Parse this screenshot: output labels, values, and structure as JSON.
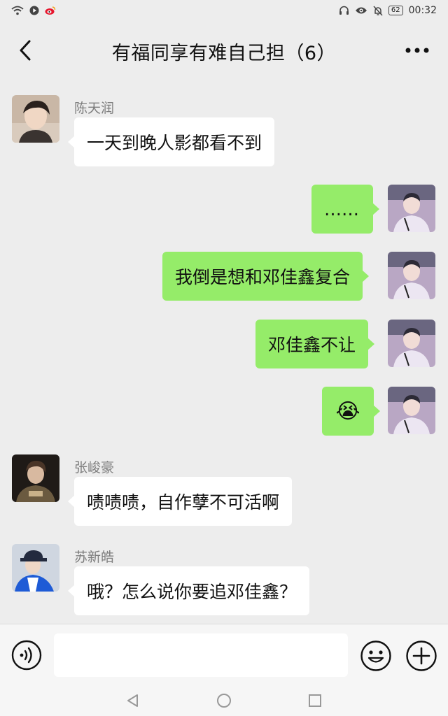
{
  "status_bar": {
    "time": "00:32",
    "battery": "62",
    "left_icons": [
      "wifi-icon",
      "play-icon",
      "weibo-icon"
    ],
    "right_icons": [
      "headset-icon",
      "eye-icon",
      "bell-off-icon",
      "battery-icon"
    ]
  },
  "header": {
    "title": "有福同享有难自己担（6）",
    "back_icon": "chevron-left-icon",
    "more_icon": "more-dots-icon"
  },
  "messages": [
    {
      "direction": "in",
      "sender": "陈天润",
      "text": "一天到晚人影都看不到",
      "avatar": "avatar-chentianrun"
    },
    {
      "direction": "out",
      "text": "……",
      "avatar": "avatar-self"
    },
    {
      "direction": "out",
      "text": "我倒是想和邓佳鑫复合",
      "avatar": "avatar-self"
    },
    {
      "direction": "out",
      "text": "邓佳鑫不让",
      "avatar": "avatar-self"
    },
    {
      "direction": "out",
      "text": "😭",
      "avatar": "avatar-self"
    },
    {
      "direction": "in",
      "sender": "张峻豪",
      "text": "啧啧啧，自作孽不可活啊",
      "avatar": "avatar-zhangjunhao"
    },
    {
      "direction": "in",
      "sender": "苏新皓",
      "text": "哦？怎么说你要追邓佳鑫？",
      "avatar": "avatar-suxinhao"
    }
  ],
  "input_bar": {
    "voice_icon": "voice-icon",
    "input_value": "",
    "emoji_icon": "emoji-icon",
    "plus_icon": "plus-icon"
  },
  "nav_bar": {
    "back_icon": "triangle-back-icon",
    "home_icon": "circle-home-icon",
    "recents_icon": "square-recents-icon"
  },
  "colors": {
    "background": "#ededed",
    "bubble_out": "#95ec69",
    "bubble_in": "#ffffff",
    "sender_name": "#7d7d7d"
  }
}
